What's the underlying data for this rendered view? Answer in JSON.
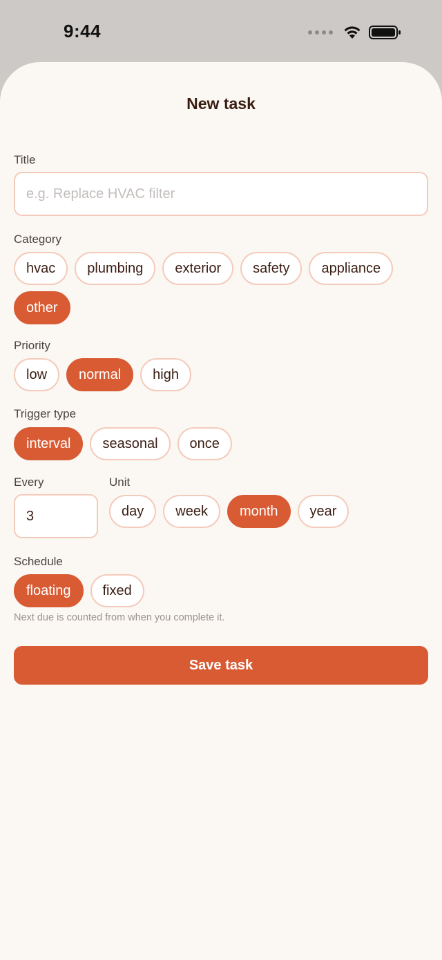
{
  "status_bar": {
    "time": "9:44"
  },
  "sheet": {
    "title": "New task"
  },
  "title_field": {
    "label": "Title",
    "placeholder": "e.g. Replace HVAC filter"
  },
  "category": {
    "label": "Category",
    "options": [
      "hvac",
      "plumbing",
      "exterior",
      "safety",
      "appliance",
      "other"
    ],
    "selected": "other"
  },
  "priority": {
    "label": "Priority",
    "options": [
      "low",
      "normal",
      "high"
    ],
    "selected": "normal"
  },
  "trigger_type": {
    "label": "Trigger type",
    "options": [
      "interval",
      "seasonal",
      "once"
    ],
    "selected": "interval"
  },
  "every": {
    "label": "Every",
    "value": "3"
  },
  "unit": {
    "label": "Unit",
    "options": [
      "day",
      "week",
      "month",
      "year"
    ],
    "selected": "month"
  },
  "schedule": {
    "label": "Schedule",
    "options": [
      "floating",
      "fixed"
    ],
    "selected": "floating",
    "hint": "Next due is counted from when you complete it."
  },
  "save_button": {
    "label": "Save task"
  },
  "colors": {
    "accent": "#d85b33",
    "chip_border": "#f4cbbb",
    "background": "#fbf7f3",
    "title_text": "#3a1d12"
  }
}
